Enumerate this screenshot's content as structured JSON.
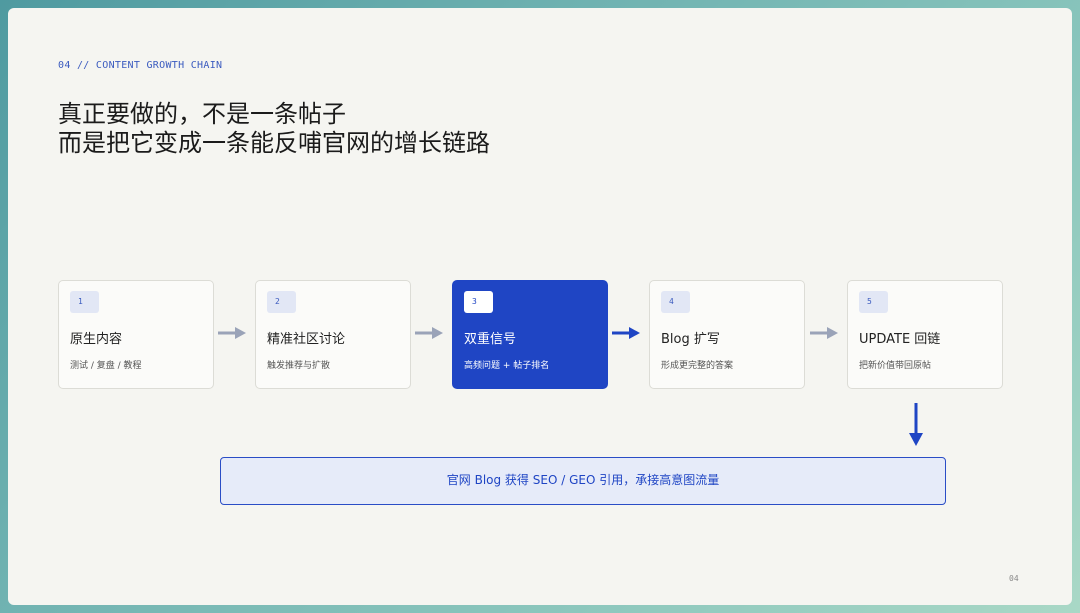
{
  "kicker": "04 // CONTENT GROWTH CHAIN",
  "title": {
    "line1": "真正要做的，不是一条帖子",
    "line2": "而是把它变成一条能反哺官网的增长链路"
  },
  "steps": [
    {
      "num": "1",
      "name": "原生内容",
      "desc": "测试 / 复盘 / 教程",
      "active": false
    },
    {
      "num": "2",
      "name": "精准社区讨论",
      "desc": "触发推荐与扩散",
      "active": false
    },
    {
      "num": "3",
      "name": "双重信号",
      "desc": "高频问题 + 帖子排名",
      "active": true
    },
    {
      "num": "4",
      "name": "Blog 扩写",
      "desc": "形成更完整的答案",
      "active": false
    },
    {
      "num": "5",
      "name": "UPDATE 回链",
      "desc": "把新价值带回原帖",
      "active": false
    }
  ],
  "result": "官网 Blog 获得 SEO / GEO 引用，承接高意图流量",
  "page_number": "04",
  "colors": {
    "accent": "#1f45c4",
    "muted_arrow": "#9aa3b8",
    "card_bg": "#fbfbf9",
    "result_bg": "#e6ebf9"
  }
}
